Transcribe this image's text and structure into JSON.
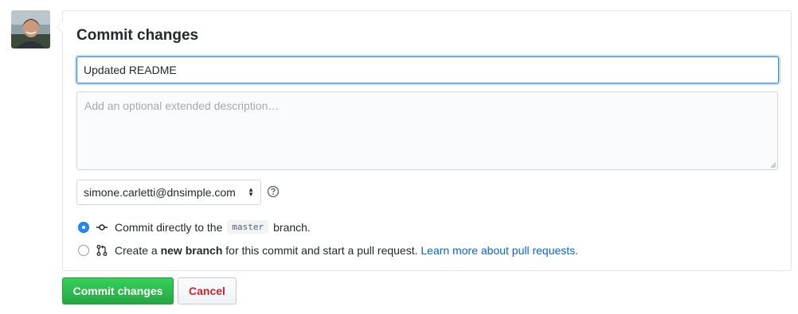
{
  "form": {
    "title": "Commit changes",
    "summary_value": "Updated README",
    "description_placeholder": "Add an optional extended description…",
    "author_email": "simone.carletti@dnsimple.com"
  },
  "options": {
    "direct": {
      "prefix": "Commit directly to the",
      "branch": "master",
      "suffix": "branch.",
      "selected": true
    },
    "new_branch": {
      "prefix": "Create a",
      "bold": "new branch",
      "middle": "for this commit and start a pull request.",
      "link": "Learn more about pull requests.",
      "selected": false
    }
  },
  "buttons": {
    "commit": "Commit changes",
    "cancel": "Cancel"
  },
  "colors": {
    "accent_blue": "#2188ff",
    "link_blue": "#0366d6",
    "commit_green": "#28a745",
    "cancel_red": "#cb2431"
  },
  "icons": {
    "direct": "git-commit-icon",
    "new_branch": "git-pull-request-icon",
    "help": "question-icon",
    "select": "select-arrows-icon"
  }
}
